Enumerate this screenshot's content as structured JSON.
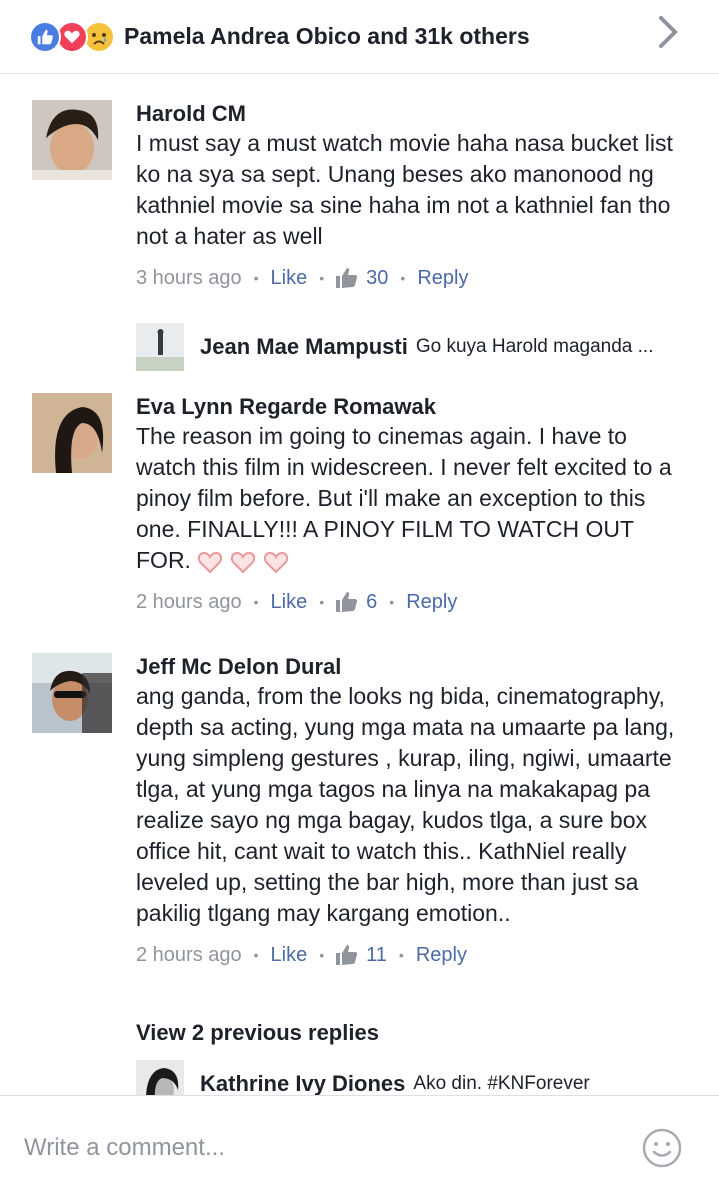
{
  "header": {
    "reaction_icons": [
      "like-icon",
      "love-icon",
      "sad-icon"
    ],
    "title": "Pamela Andrea Obico and 31k others"
  },
  "comments": [
    {
      "author": "Harold CM",
      "text": "I must say a must watch movie haha nasa bucket list ko na sya sa sept. Unang beses ako manonood ng kathniel movie sa sine haha im not a kathniel fan tho not a hater as well",
      "time": "3 hours ago",
      "like_label": "Like",
      "likes": "30",
      "reply_label": "Reply"
    },
    {
      "author": "Eva Lynn Regarde Romawak",
      "text": "The reason im going to cinemas again.  I have to watch this film in widescreen. I never felt excited to a pinoy film before. But i'll make an exception to this one. FINALLY!!! A PINOY FILM TO WATCH OUT FOR.",
      "time": "2 hours ago",
      "like_label": "Like",
      "likes": "6",
      "reply_label": "Reply"
    },
    {
      "author": "Jeff Mc Delon Dural",
      "text": "ang ganda, from the looks ng bida, cinematography, depth sa acting, yung mga mata na umaarte pa lang, yung simpleng gestures , kurap, iling, ngiwi, umaarte tlga, at yung mga tagos na linya na makakapag pa realize sayo ng mga bagay, kudos tlga, a sure box office hit, cant wait to watch this.. KathNiel really leveled up, setting the bar high, more than just sa pakilig tlgang may kargang emotion..",
      "time": "2 hours ago",
      "like_label": "Like",
      "likes": "11",
      "reply_label": "Reply"
    }
  ],
  "replies": [
    {
      "author": "Jean Mae Mampusti",
      "text": "Go kuya Harold maganda ..."
    },
    {
      "author": "Kathrine Ivy Diones",
      "text": "Ako din. #KNForever"
    }
  ],
  "view_previous": "View 2 previous replies",
  "composer": {
    "placeholder": "Write a comment..."
  },
  "colors": {
    "link": "#4b6aa6",
    "meta": "#90949c",
    "like_reaction": "#4a7de2",
    "love_reaction": "#f0405a",
    "sad_reaction": "#f5c33b"
  }
}
